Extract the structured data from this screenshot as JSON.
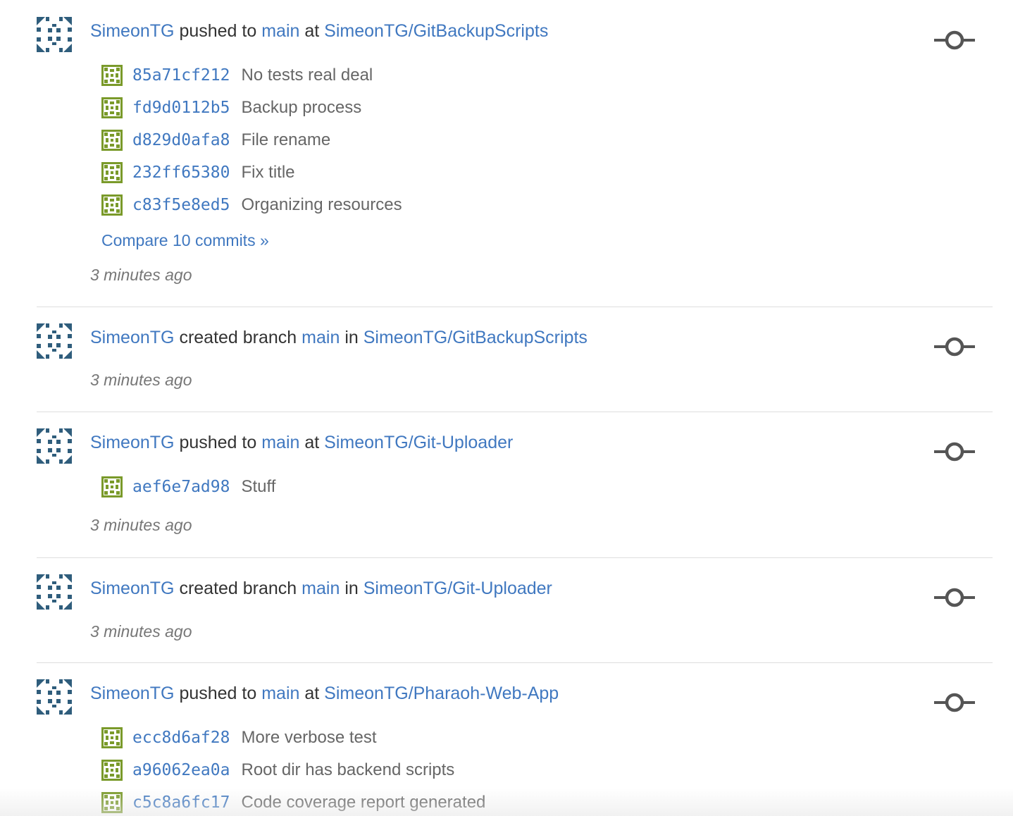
{
  "feed": {
    "items": [
      {
        "actor": "SimeonTG",
        "verb": "pushed to",
        "branch": "main",
        "prep": "at",
        "repo": "SimeonTG/GitBackupScripts",
        "commits": [
          {
            "sha": "85a71cf212",
            "message": "No tests real deal"
          },
          {
            "sha": "fd9d0112b5",
            "message": "Backup process"
          },
          {
            "sha": "d829d0afa8",
            "message": "File rename"
          },
          {
            "sha": "232ff65380",
            "message": "Fix title"
          },
          {
            "sha": "c83f5e8ed5",
            "message": "Organizing resources"
          }
        ],
        "compare": "Compare 10 commits »",
        "time": "3 minutes ago"
      },
      {
        "actor": "SimeonTG",
        "verb": "created branch",
        "branch": "main",
        "prep": "in",
        "repo": "SimeonTG/GitBackupScripts",
        "commits": [],
        "time": "3 minutes ago"
      },
      {
        "actor": "SimeonTG",
        "verb": "pushed to",
        "branch": "main",
        "prep": "at",
        "repo": "SimeonTG/Git-Uploader",
        "commits": [
          {
            "sha": "aef6e7ad98",
            "message": "Stuff"
          }
        ],
        "time": "3 minutes ago"
      },
      {
        "actor": "SimeonTG",
        "verb": "created branch",
        "branch": "main",
        "prep": "in",
        "repo": "SimeonTG/Git-Uploader",
        "commits": [],
        "time": "3 minutes ago"
      },
      {
        "actor": "SimeonTG",
        "verb": "pushed to",
        "branch": "main",
        "prep": "at",
        "repo": "SimeonTG/Pharaoh-Web-App",
        "commits": [
          {
            "sha": "ecc8d6af28",
            "message": "More verbose test"
          },
          {
            "sha": "a96062ea0a",
            "message": "Root dir has backend scripts"
          },
          {
            "sha": "c5c8a6fc17",
            "message": "Code coverage report generated"
          }
        ]
      }
    ]
  },
  "icons": {
    "user_avatar": "identicon-avatar",
    "commit_avatar": "identicon-avatar",
    "event_icon": "git-commit-icon"
  },
  "colors": {
    "link": "#4078c0",
    "text": "#333333",
    "muted": "#666666",
    "time": "#777777",
    "avatar": "#2f5d7c",
    "commit_avatar": "#7a9a2a",
    "icon": "#555555",
    "divider": "#dedede"
  }
}
